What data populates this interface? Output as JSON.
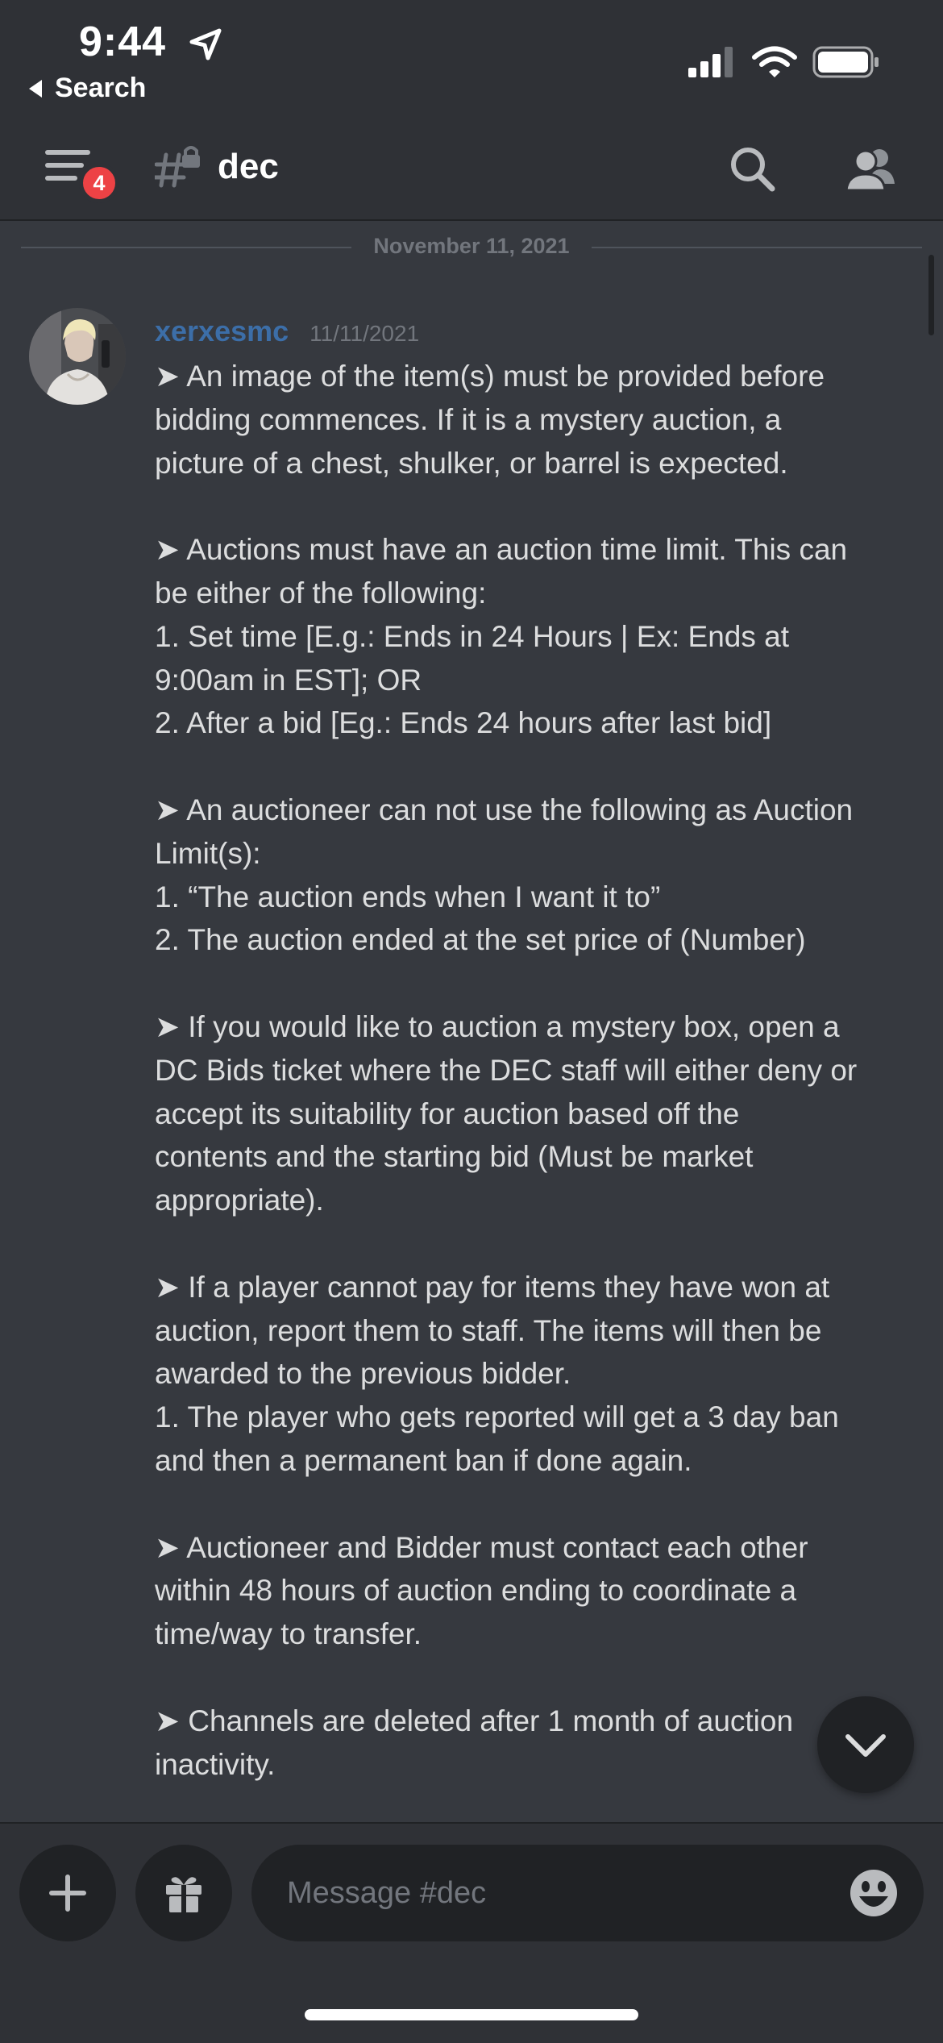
{
  "status_bar": {
    "time": "9:44",
    "back_label": "Search"
  },
  "header": {
    "unread_badge": "4",
    "channel_name": "dec"
  },
  "messages": {
    "date_divider": "November 11, 2021",
    "message": {
      "author": "xerxesmc",
      "timestamp": "11/11/2021",
      "lines": [
        "➤ An image of the item(s) must be provided before",
        "bidding commences. If it is a mystery auction, a",
        "picture of a chest, shulker, or barrel is expected.",
        "",
        "➤ Auctions must have an auction time limit. This can",
        "be either of the following:",
        "1. Set time [E.g.: Ends in 24 Hours | Ex: Ends at",
        "9:00am in EST]; OR",
        "2. After a bid [Eg.: Ends 24 hours after last bid]",
        "",
        "➤ An auctioneer can not use the following as Auction",
        "Limit(s):",
        "1. “The auction ends when I want it to”",
        "2. The auction ended at the set price of (Number)",
        "",
        "➤ If you would like to auction a mystery box, open a",
        "DC Bids ticket where the DEC staff will either deny or",
        "accept its suitability for auction based off the",
        "contents and the starting bid (Must be market",
        "appropriate).",
        "",
        "➤ If a player cannot pay for items they have won at",
        "auction, report them to staff. The items will then be",
        "awarded to the previous bidder.",
        "1. The player who gets reported will get a 3 day ban",
        "and then a permanent ban if done again.",
        "",
        "➤ Auctioneer and Bidder must contact each other",
        "within 48 hours of auction ending to coordinate a",
        "time/way to transfer.",
        "",
        "➤ Channels are deleted after 1 month of auction",
        "inactivity."
      ]
    }
  },
  "composer": {
    "placeholder": "Message #dec"
  },
  "colors": {
    "background": "#36393f",
    "bars": "#2f3136",
    "badge": "#ed4245",
    "author": "#3c6ea8"
  }
}
